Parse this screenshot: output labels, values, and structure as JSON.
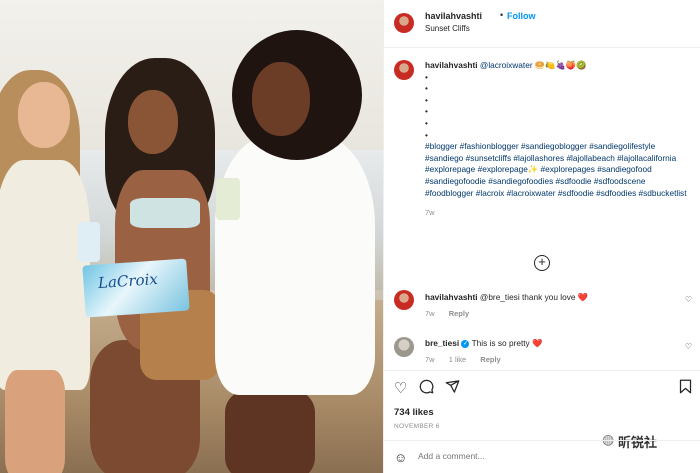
{
  "header": {
    "username": "havilahvashti",
    "separator": "•",
    "follow_label": "Follow",
    "location": "Sunset Cliffs"
  },
  "caption": {
    "username": "havilahvashti",
    "mention": "@lacroixwater",
    "emojis": "🥯🍋🍇🍑🥝",
    "bullets": [
      "•",
      "•",
      "•",
      "•",
      "•",
      "•"
    ],
    "hashtags": "#blogger #fashionblogger #sandiegoblogger #sandiegolifestyle #sandiego #sunsetcliffs #lajollashores #lajollabeach #lajollacalifornia #explorepage #explorepage✨ #explorepages #sandiegofood #sandiegofoodie #sandiegofoodies #sdfoodie #sdfoodscene #foodblogger #lacroix #lacroixwater #sdfoodie #sdfoodies #sdbucketlist",
    "time": "7w"
  },
  "comments": [
    {
      "username": "havilahvashti",
      "text": "@bre_tiesi thank you love",
      "heart": "❤️",
      "time": "7w",
      "reply": "Reply"
    },
    {
      "username": "bre_tiesi",
      "verified": "✓",
      "text": "This is so pretty",
      "heart": "❤️",
      "time": "7w",
      "likes": "1 like",
      "reply": "Reply"
    }
  ],
  "actions": {
    "likes": "734 likes",
    "date": "NOVEMBER 6",
    "add_comment_placeholder": "Add a comment..."
  },
  "photo": {
    "product_label": "LaCroix"
  },
  "watermark": "昕锐社",
  "icons": [
    "heart-icon",
    "comment-icon",
    "share-icon",
    "bookmark-icon",
    "emoji-icon",
    "add-icon",
    "more-icon"
  ],
  "colors": {
    "link": "#0095f6",
    "hashtag": "#00376b",
    "muted": "#8e8e8e",
    "heart": "#e0245e"
  }
}
